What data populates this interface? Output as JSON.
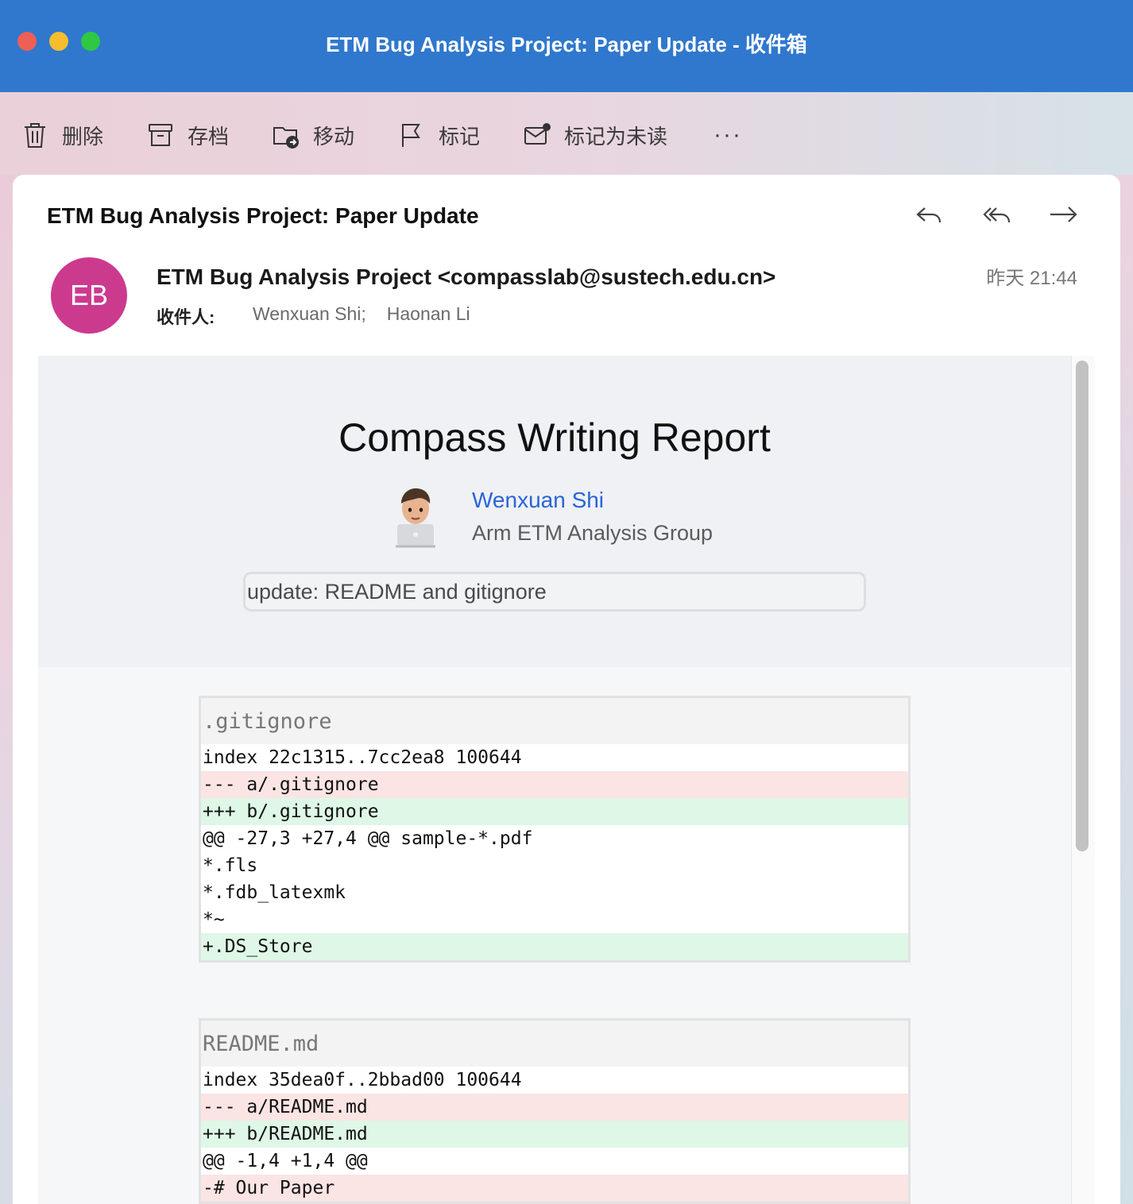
{
  "window": {
    "title": "ETM Bug Analysis Project: Paper Update - 收件箱"
  },
  "toolbar": {
    "delete": "删除",
    "archive": "存档",
    "move": "移动",
    "flag": "标记",
    "mark_unread": "标记为未读",
    "more": "···"
  },
  "email": {
    "subject": "ETM Bug Analysis Project: Paper Update",
    "avatar_initials": "EB",
    "sender": "ETM Bug Analysis Project <compasslab@sustech.edu.cn>",
    "date": "昨天 21:44",
    "to_label": "收件人:",
    "recipients": [
      "Wenxuan Shi;",
      "Haonan Li"
    ]
  },
  "report": {
    "title": "Compass Writing Report",
    "author_name": "Wenxuan Shi",
    "author_group": "Arm ETM Analysis Group",
    "commit_message": "update: README and gitignore"
  },
  "diffs": [
    {
      "file": ".gitignore",
      "lines": [
        {
          "type": "ctx",
          "text": "index 22c1315..7cc2ea8 100644"
        },
        {
          "type": "del",
          "text": "--- a/.gitignore"
        },
        {
          "type": "add",
          "text": "+++ b/.gitignore"
        },
        {
          "type": "ctx",
          "text": "@@ -27,3 +27,4 @@ sample-*.pdf"
        },
        {
          "type": "ctx",
          "text": "*.fls"
        },
        {
          "type": "ctx",
          "text": "*.fdb_latexmk"
        },
        {
          "type": "ctx",
          "text": "*~"
        },
        {
          "type": "add",
          "text": "+.DS_Store"
        }
      ]
    },
    {
      "file": "README.md",
      "lines": [
        {
          "type": "ctx",
          "text": "index 35dea0f..2bbad00 100644"
        },
        {
          "type": "del",
          "text": "--- a/README.md"
        },
        {
          "type": "add",
          "text": "+++ b/README.md"
        },
        {
          "type": "ctx",
          "text": "@@ -1,4 +1,4 @@"
        },
        {
          "type": "del",
          "text": "-# Our Paper"
        }
      ]
    }
  ],
  "colors": {
    "titlebar": "#3078cd",
    "avatar": "#cc3a8e",
    "link": "#2a63d6",
    "diff_del": "#fbe4e4",
    "diff_add": "#def7e6"
  }
}
